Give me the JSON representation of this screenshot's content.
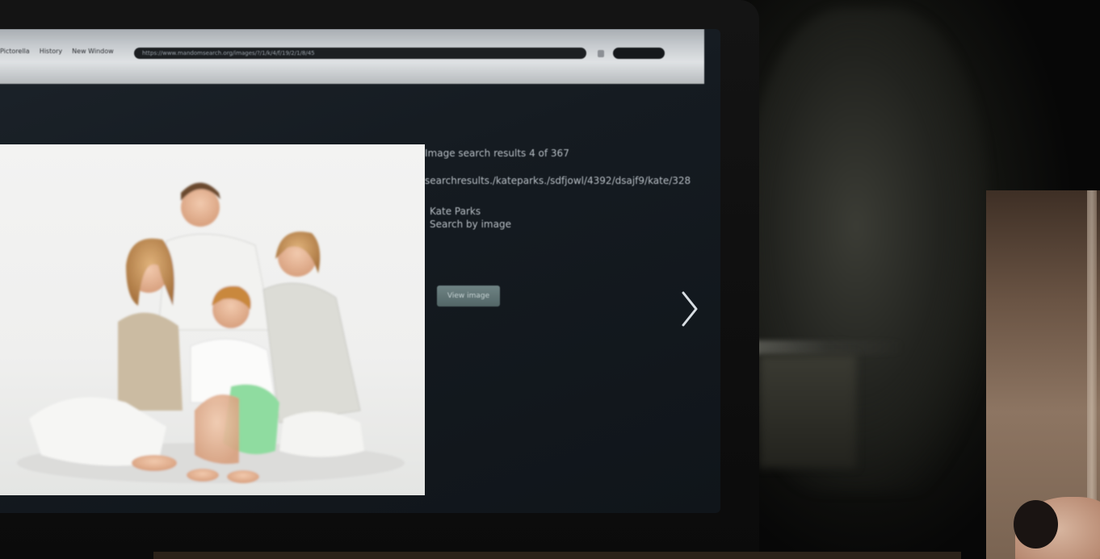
{
  "browser": {
    "menu": [
      "Pictorella",
      "History",
      "New Window"
    ],
    "url": "https://www.mandomsearch.org/images/?/1/k/4/f/19/2/1/8/45"
  },
  "result": {
    "count_text": "Image search results  4 of 367",
    "result_path": "searchresults./kateparks./sdfjowl/4392/dsajf9/kate/328",
    "name": "Kate Parks",
    "search_by_image": "Search by image",
    "view_button": "View image"
  },
  "colors": {
    "screen_bg": "#151b21",
    "button": "#5f7374",
    "browser_chrome": "#c7cbcf"
  },
  "icons": {
    "next": "chevron-right-icon",
    "lock": "lock-icon"
  }
}
